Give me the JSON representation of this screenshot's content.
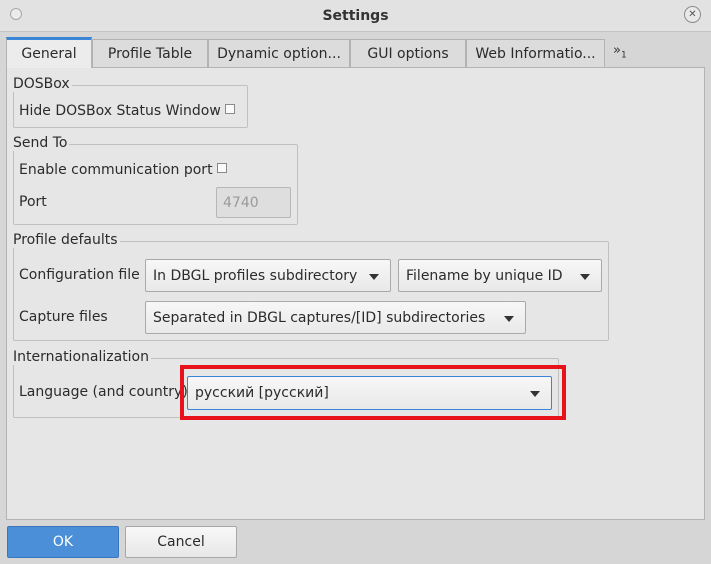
{
  "window": {
    "title": "Settings"
  },
  "tabs": [
    {
      "label": "General"
    },
    {
      "label": "Profile Table"
    },
    {
      "label": "Dynamic option..."
    },
    {
      "label": "GUI options"
    },
    {
      "label": "Web Informatio..."
    }
  ],
  "tab_overflow": {
    "symbol": "»",
    "count": "1"
  },
  "dosbox": {
    "title": "DOSBox",
    "hide_status_label": "Hide DOSBox Status Window",
    "hide_status_checked": false
  },
  "send_to": {
    "title": "Send To",
    "enable_port_label": "Enable communication port",
    "enable_port_checked": false,
    "port_label": "Port",
    "port_value": "4740"
  },
  "profile_defaults": {
    "title": "Profile defaults",
    "config_file_label": "Configuration file",
    "config_location": "In DBGL profiles subdirectory",
    "config_naming": "Filename by unique ID",
    "capture_label": "Capture files",
    "capture_location": "Separated in DBGL captures/[ID] subdirectories"
  },
  "i18n": {
    "title": "Internationalization",
    "language_label": "Language (and country)",
    "language_value": "русский [русский]"
  },
  "buttons": {
    "ok": "OK",
    "cancel": "Cancel"
  },
  "colors": {
    "accent": "#3a86d6",
    "highlight": "#e8121b",
    "ok_button": "#4a8fd8"
  }
}
